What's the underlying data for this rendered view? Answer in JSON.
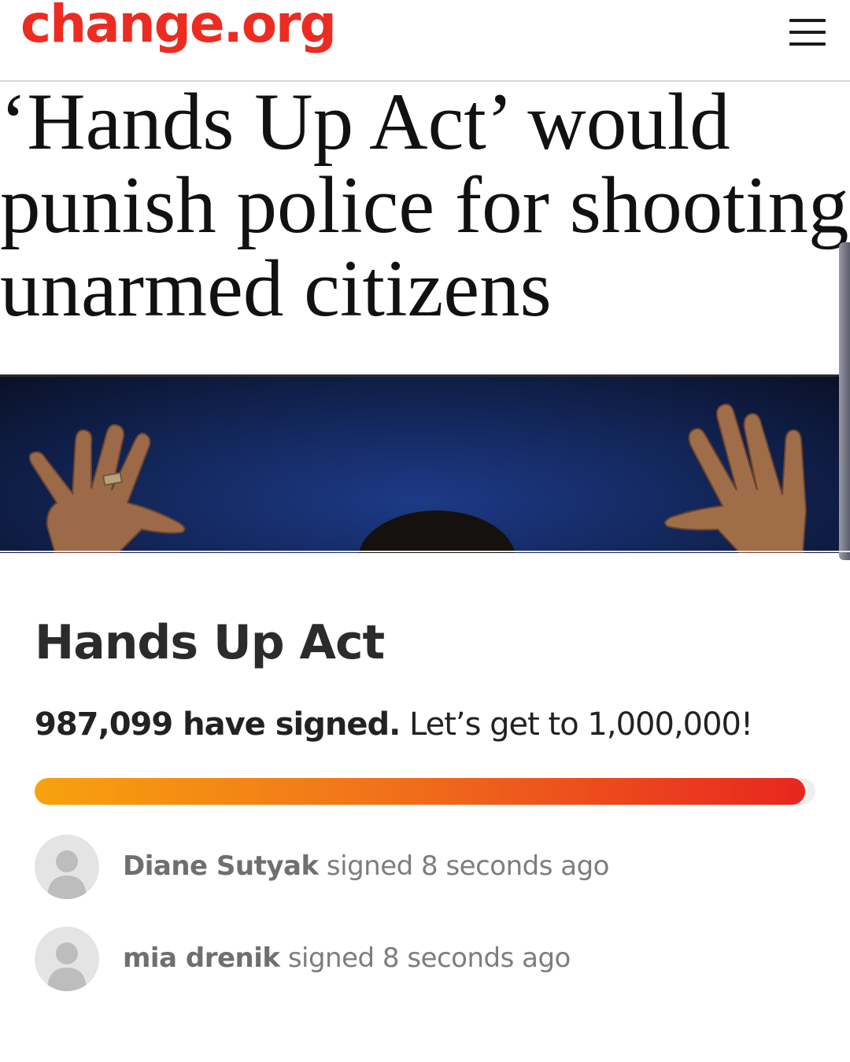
{
  "header": {
    "logo_text": "change.org",
    "menu_icon": "hamburger-menu-icon",
    "brand_color": "#ec2c22"
  },
  "article": {
    "headline_lines": [
      "‘Hands Up Act’ would",
      "punish police for shooting",
      "unarmed citizens"
    ]
  },
  "petition": {
    "title": "Hands Up Act",
    "signed_count": "987,099 have signed.",
    "goal_text": "Let’s get to 1,000,000!",
    "progress_fraction": 0.987,
    "progress_colors": [
      "#f7a20d",
      "#f1721a",
      "#e7261f"
    ]
  },
  "recent_signers": [
    {
      "name": "Diane Sutyak",
      "action": "signed",
      "time": "8 seconds ago"
    },
    {
      "name": "mia drenik",
      "action": "signed",
      "time": "8 seconds ago"
    }
  ]
}
